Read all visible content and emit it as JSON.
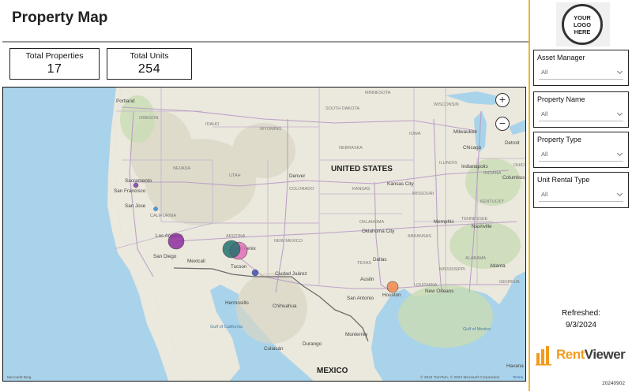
{
  "header": {
    "title": "Property Map"
  },
  "kpis": {
    "total_properties": {
      "label": "Total Properties",
      "value": "17"
    },
    "total_units": {
      "label": "Total Units",
      "value": "254"
    }
  },
  "map": {
    "zoom_in": "+",
    "zoom_out": "−",
    "attribution": "© 2024 TomTom, © 2024 Microsoft Corporation",
    "terms": "Terms",
    "provider": "Microsoft Bing",
    "country_labels": {
      "us": "UNITED STATES",
      "mexico": "MEXICO"
    },
    "state_labels": [
      "OREGON",
      "IDAHO",
      "WYOMING",
      "NEVADA",
      "UTAH",
      "COLORADO",
      "CALIFORNIA",
      "ARIZONA",
      "NEW MEXICO",
      "SOUTH DAKOTA",
      "NEBRASKA",
      "KANSAS",
      "OKLAHOMA",
      "TEXAS",
      "IOWA",
      "MISSOURI",
      "ARKANSAS",
      "MISSISSIPPI",
      "ALABAMA",
      "TENNESSEE",
      "KENTUCKY",
      "ILLINOIS",
      "INDIANA",
      "OHIO",
      "WISCONSIN",
      "MINNESOTA",
      "GEORGIA",
      "LOUISIANA"
    ],
    "city_labels": [
      "Portland",
      "Sacramento",
      "San Francisco",
      "San Jose",
      "Los Angeles",
      "San Diego",
      "Mexicali",
      "Phoenix",
      "Tucson",
      "Hermosillo",
      "Chihuahua",
      "Ciudad Juárez",
      "Denver",
      "Kansas City",
      "Oklahoma City",
      "Dallas",
      "Austin",
      "San Antonio",
      "Houston",
      "Memphis",
      "Chicago",
      "Milwaukee",
      "Detroit",
      "Indianapolis",
      "Columbus",
      "Nashville",
      "Atlanta",
      "Monterrey",
      "Culiacán",
      "Durango",
      "New Orleans",
      "Havana"
    ],
    "water_labels": [
      "Gulf of Mexico",
      "Gulf of California"
    ],
    "markers": [
      {
        "place": "Sacramento",
        "color": "#7b3fa8"
      },
      {
        "place": "San Jose",
        "color": "#2f8fe3"
      },
      {
        "place": "Los Angeles",
        "color": "#8e2fa0"
      },
      {
        "place": "Phoenix A",
        "color": "#1f6e6b"
      },
      {
        "place": "Phoenix B",
        "color": "#e36fb9"
      },
      {
        "place": "Tucson",
        "color": "#3d4fb8"
      },
      {
        "place": "Houston",
        "color": "#f28a4f"
      }
    ]
  },
  "slicers": [
    {
      "label": "Asset Manager",
      "value": "All"
    },
    {
      "label": "Property Name",
      "value": "All"
    },
    {
      "label": "Property Type",
      "value": "All"
    },
    {
      "label": "Unit Rental Type",
      "value": "All"
    }
  ],
  "logo": {
    "line1": "YOUR",
    "line2": "LOGO",
    "line3": "HERE"
  },
  "refresh": {
    "label": "Refreshed:",
    "date": "9/3/2024"
  },
  "brand": {
    "part1": "Rent",
    "part2": "Viewer",
    "accent": "#f29b1d"
  },
  "footer": {
    "version": "20240902"
  }
}
